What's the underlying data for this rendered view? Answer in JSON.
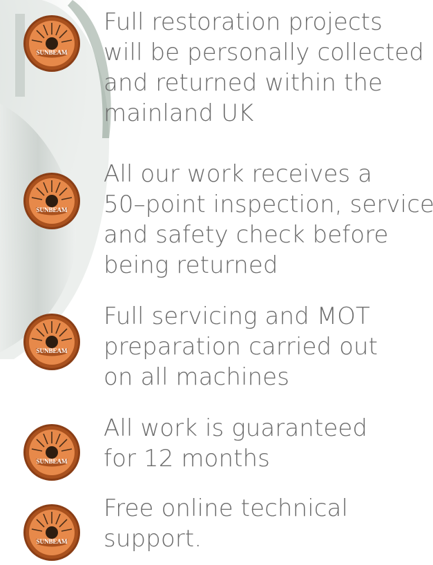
{
  "badge": {
    "text": "SUNBEAM",
    "icon": "sunbeam-sun-logo",
    "colors": {
      "ring": "#a9511e",
      "fill": "#e7894a",
      "sun": "#2e1d10",
      "text": "#ffffff"
    }
  },
  "text_color": "#6b6b6b",
  "features": [
    {
      "lines": [
        "Full restoration projects",
        "will be personally collected",
        "and returned within the",
        "mainland UK"
      ]
    },
    {
      "lines": [
        "All our work receives a",
        "50–point inspection, service",
        "and safety check before",
        "being returned"
      ]
    },
    {
      "lines": [
        "Full servicing and MOT",
        "preparation carried out",
        "on all machines"
      ]
    },
    {
      "lines": [
        "All work is guaranteed",
        "for 12 months"
      ]
    },
    {
      "lines": [
        "Free online technical",
        "support."
      ]
    }
  ]
}
